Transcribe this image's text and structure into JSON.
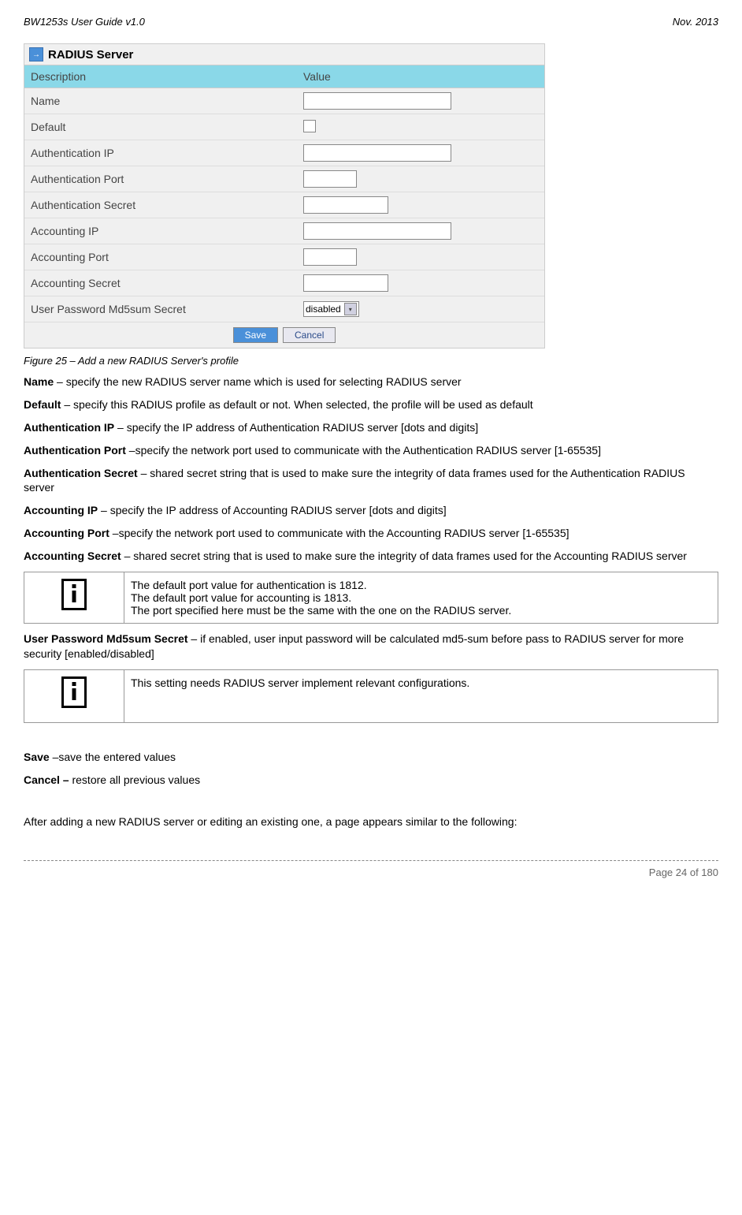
{
  "header": {
    "left": "BW1253s User Guide v1.0",
    "right": "Nov.  2013"
  },
  "panel": {
    "title": "RADIUS Server",
    "col_left": "Description",
    "col_right": "Value",
    "rows": {
      "name": "Name",
      "default": "Default",
      "auth_ip": "Authentication IP",
      "auth_port": "Authentication Port",
      "auth_secret": "Authentication Secret",
      "acct_ip": "Accounting IP",
      "acct_port": "Accounting Port",
      "acct_secret": "Accounting Secret",
      "md5_secret": "User Password Md5sum Secret"
    },
    "md5_value": "disabled",
    "save": "Save",
    "cancel": "Cancel"
  },
  "caption": "Figure 25 – Add a new RADIUS Server's profile",
  "paras": {
    "p1_b": "Name",
    "p1_t": " – specify the new RADIUS server name which is used for selecting RADIUS server",
    "p2_b": "Default",
    "p2_t": " – specify this RADIUS profile as default or not. When selected, the profile will be used as default",
    "p3_b": "Authentication IP",
    "p3_t": " – specify the IP address of Authentication RADIUS server [dots and digits]",
    "p4_b": "Authentication Port",
    "p4_t": " –specify the network port used to communicate with the Authentication RADIUS server [1-65535]",
    "p5_b": "Authentication Secret",
    "p5_t": " – shared secret string that is used to make sure the integrity of data frames used for the Authentication RADIUS server",
    "p6_b": "Accounting IP",
    "p6_t": " – specify the IP address of Accounting RADIUS server [dots and digits]",
    "p7_b": "Accounting Port",
    "p7_t": " –specify the network port used to communicate with the Accounting RADIUS server [1-65535]",
    "p8_b": "Accounting Secret",
    "p8_t": " – shared secret string that is used to make sure the integrity of data frames used for the Accounting RADIUS server"
  },
  "info1": {
    "l1": "The default port value for authentication is 1812.",
    "l2": "The default port value for accounting is 1813.",
    "l3": "The port specified here must be the same with the one on the RADIUS server."
  },
  "p9_b": "User Password Md5sum Secret",
  "p9_t": " – if enabled, user input password will be calculated md5-sum before pass to RADIUS server for more security [enabled/disabled]",
  "info2": "This setting needs RADIUS server implement relevant configurations.",
  "p10_b": "Save",
  "p10_t": " –save the entered values",
  "p11_b": "Cancel –",
  "p11_t": " restore all previous values",
  "p12": "After adding a new RADIUS server or editing an existing one, a page appears similar to the following:",
  "footer": "Page 24 of 180"
}
